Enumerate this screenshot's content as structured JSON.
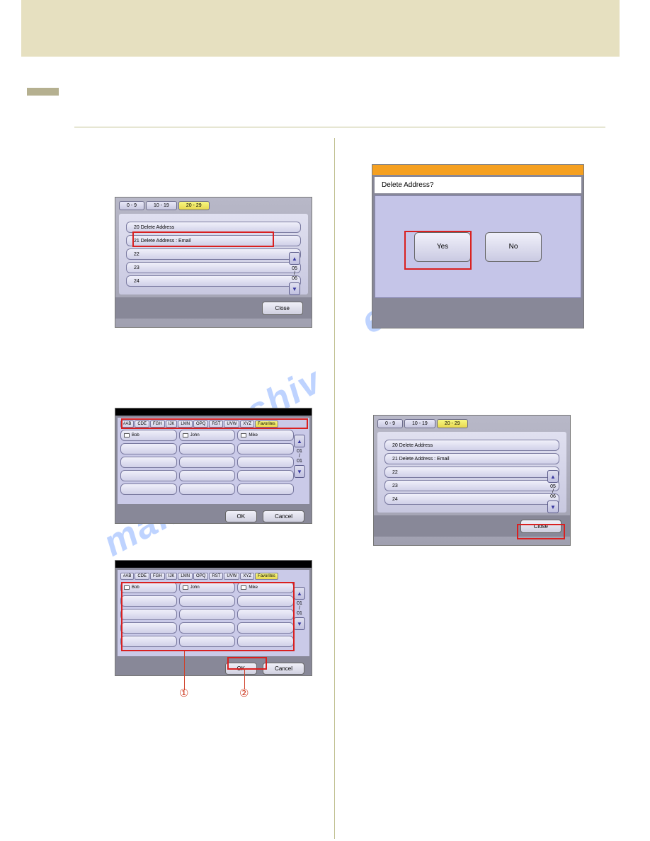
{
  "panelA": {
    "tabs": [
      "0 - 9",
      "10 - 19",
      "20 - 29"
    ],
    "rows": [
      "20  Delete Address",
      "21  Delete Address : Email",
      "22",
      "23",
      "24"
    ],
    "counter": {
      "a": "05",
      "b": "06"
    },
    "close": "Close"
  },
  "panelB": {
    "title": "Delete Address?",
    "yes": "Yes",
    "no": "No"
  },
  "panelC": {
    "tabs": [
      "#AB",
      "CDE",
      "FGH",
      "IJK",
      "LMN",
      "OPQ",
      "RST",
      "UVW",
      "XYZ",
      "Favorites"
    ],
    "names": [
      "Bob",
      "John",
      "Mike"
    ],
    "counter": {
      "a": "01",
      "b": "01"
    },
    "ok": "OK",
    "cancel": "Cancel"
  },
  "callouts": {
    "c1": "①",
    "c2": "②"
  }
}
